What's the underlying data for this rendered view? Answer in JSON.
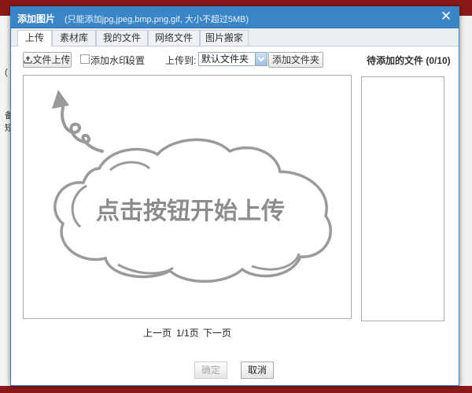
{
  "background": {
    "marks": [
      "(",
      "备",
      "短"
    ]
  },
  "dialog": {
    "title": "添加图片",
    "subtitle": "(只能添加jpg,jpeg,bmp,png,gif, 大小不超过5MB)",
    "close_label": "✕"
  },
  "tabs": [
    {
      "label": "上传",
      "active": true
    },
    {
      "label": "素材库"
    },
    {
      "label": "我的文件"
    },
    {
      "label": "网络文件"
    },
    {
      "label": "图片搬家"
    }
  ],
  "toolbar": {
    "upload_button": "文件上传",
    "watermark_label": "添加水印",
    "settings_link": "设置",
    "upload_to_label": "上传到:",
    "folder_select_value": "默认文件夹",
    "add_folder_button": "添加文件夹"
  },
  "pending": {
    "title": "待添加的文件 (0/10)"
  },
  "upload_area": {
    "hint": "点击按钮开始上传"
  },
  "pager": {
    "prev": "上一页",
    "page": "1/1页",
    "next": "下一页"
  },
  "footer": {
    "confirm": "确定",
    "cancel": "取消"
  },
  "colors": {
    "titlebar": "#3a85c8",
    "cloud_stroke": "#9a9a9a",
    "hint_text": "#8c8c8c"
  }
}
